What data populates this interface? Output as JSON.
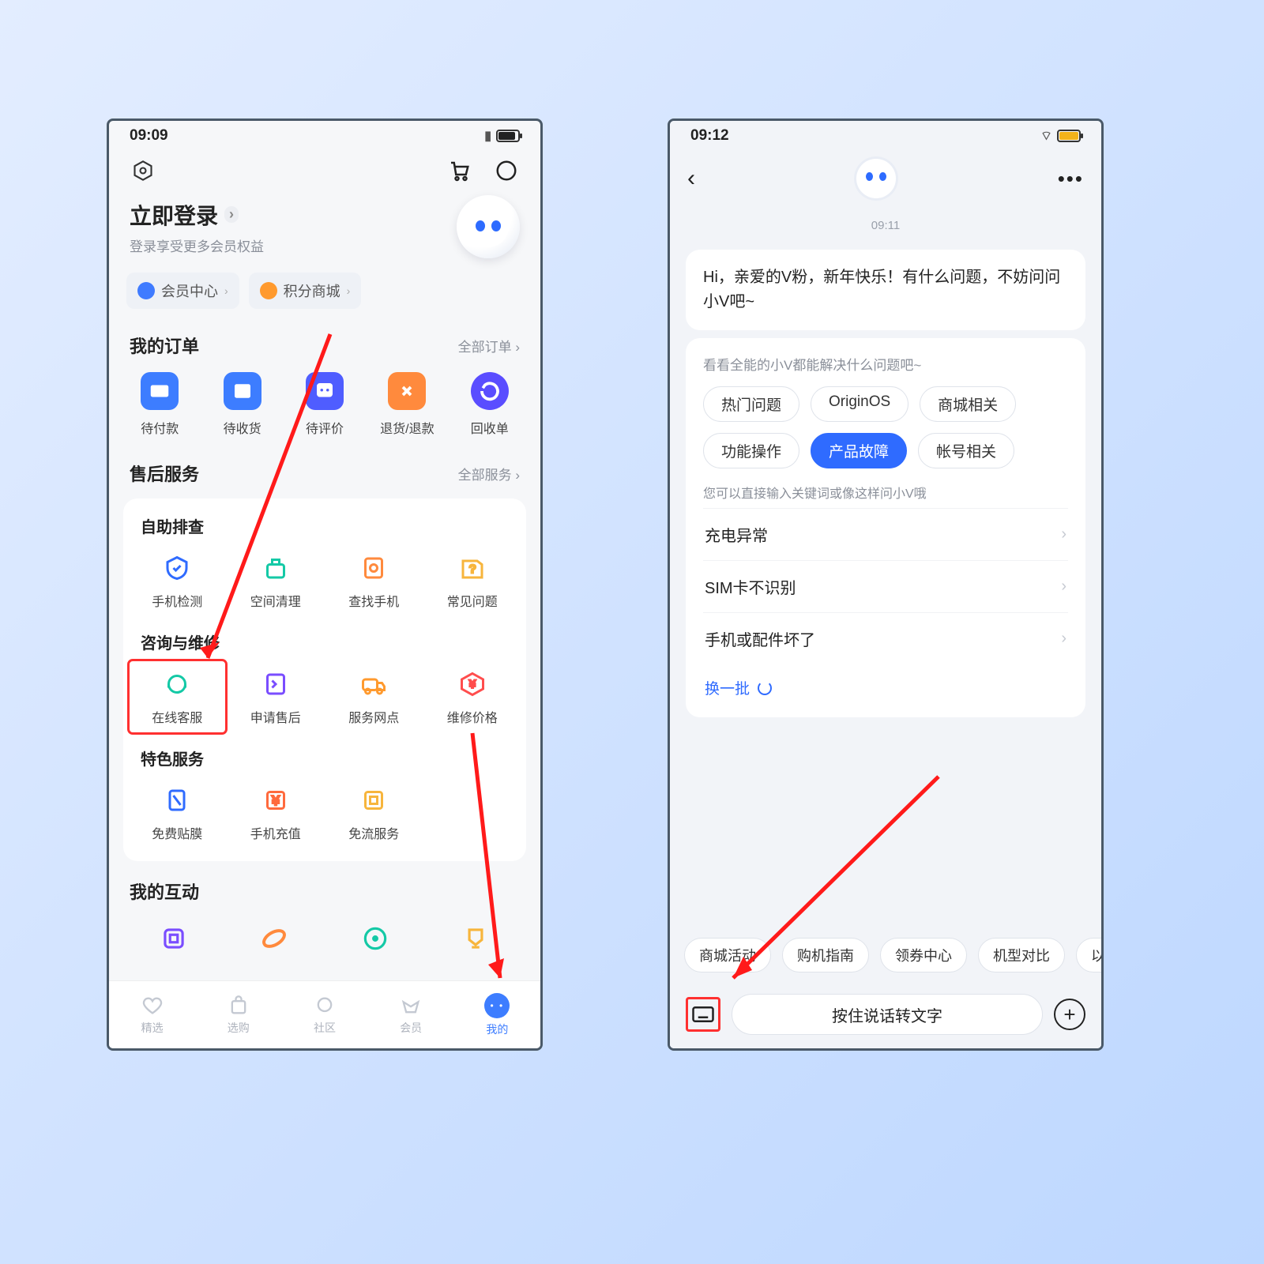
{
  "left": {
    "status_time": "09:09",
    "login_title": "立即登录",
    "login_sub": "登录享受更多会员权益",
    "chips": {
      "member": "会员中心",
      "points": "积分商城"
    },
    "orders": {
      "title": "我的订单",
      "all": "全部订单 ›",
      "items": [
        "待付款",
        "待收货",
        "待评价",
        "退货/退款",
        "回收单"
      ]
    },
    "services": {
      "title": "售后服务",
      "all": "全部服务 ›",
      "g1_title": "自助排查",
      "g1": [
        "手机检测",
        "空间清理",
        "查找手机",
        "常见问题"
      ],
      "g2_title": "咨询与维修",
      "g2": [
        "在线客服",
        "申请售后",
        "服务网点",
        "维修价格"
      ],
      "g3_title": "特色服务",
      "g3": [
        "免费贴膜",
        "手机充值",
        "免流服务"
      ]
    },
    "interact_title": "我的互动",
    "tabs": [
      "精选",
      "选购",
      "社区",
      "会员",
      "我的"
    ]
  },
  "right": {
    "status_time": "09:12",
    "ts": "09:11",
    "greeting": "Hi，亲爱的V粉，新年快乐！有什么问题，不妨问问小V吧~",
    "hint1": "看看全能的小V都能解决什么问题吧~",
    "topics": [
      "热门问题",
      "OriginOS",
      "商城相关",
      "功能操作",
      "产品故障",
      "帐号相关"
    ],
    "topic_active": 4,
    "hint2": "您可以直接输入关键词或像这样问小V哦",
    "faq": [
      "充电异常",
      "SIM卡不识别",
      "手机或配件坏了"
    ],
    "refresh": "换一批",
    "quick": [
      "商城活动",
      "购机指南",
      "领券中心",
      "机型对比",
      "以"
    ],
    "voice_label": "按住说话转文字"
  }
}
